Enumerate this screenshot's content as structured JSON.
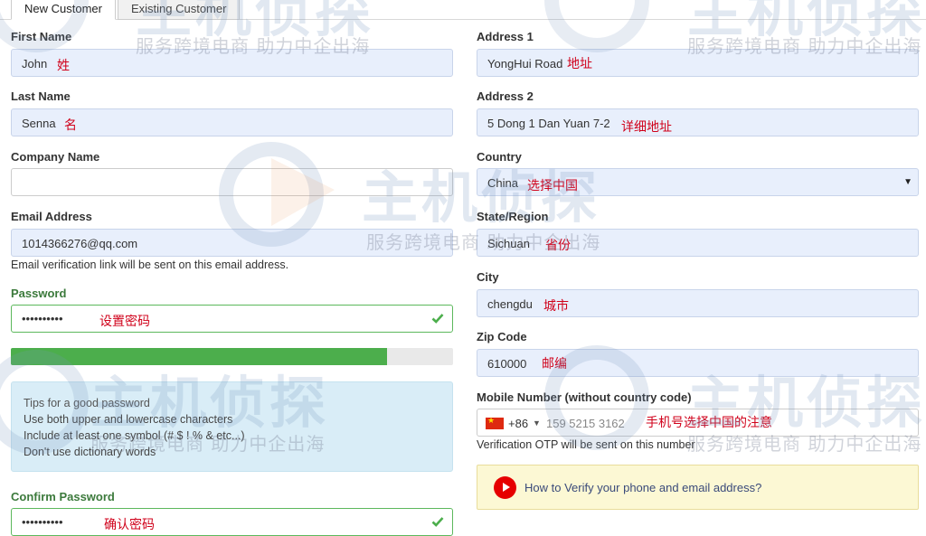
{
  "tabs": [
    {
      "label": "New Customer",
      "active": true
    },
    {
      "label": "Existing Customer",
      "active": false
    }
  ],
  "left": {
    "first_name": {
      "label": "First Name",
      "value": "John",
      "note": "姓"
    },
    "last_name": {
      "label": "Last Name",
      "value": "Senna",
      "note": "名"
    },
    "company": {
      "label": "Company Name",
      "value": ""
    },
    "email": {
      "label": "Email Address",
      "value": "1014366276@qq.com",
      "help": "Email verification link will be sent on this email address."
    },
    "password": {
      "label": "Password",
      "value": "••••••••••",
      "note": "设置密码",
      "strength": 0.85
    },
    "tips": {
      "title": "Tips for a good password",
      "lines": [
        "Use both upper and lowercase characters",
        "Include at least one symbol (# $ ! % & etc...)",
        "Don't use dictionary words"
      ]
    },
    "confirm": {
      "label": "Confirm Password",
      "value": "••••••••••",
      "note": "确认密码"
    }
  },
  "right": {
    "address1": {
      "label": "Address 1",
      "value": "YongHui Road",
      "note": "地址"
    },
    "address2": {
      "label": "Address 2",
      "value": "5 Dong 1 Dan Yuan 7-2",
      "note": "详细地址"
    },
    "country": {
      "label": "Country",
      "value": "China",
      "note": "选择中国"
    },
    "state": {
      "label": "State/Region",
      "value": "Sichuan",
      "note": "省份"
    },
    "city": {
      "label": "City",
      "value": "chengdu",
      "note": "城市"
    },
    "zip": {
      "label": "Zip Code",
      "value": "610000",
      "note": "邮编"
    },
    "mobile": {
      "label": "Mobile Number (without country code)",
      "code": "+86",
      "value": "159 5215 3162",
      "note": "手机号选择中国的注意",
      "help": "Verification OTP will be sent on this number"
    },
    "verify_link": "How to Verify your phone and email address?"
  },
  "watermark": {
    "brand": "主机侦探",
    "slogan": "服务跨境电商 助力中企出海"
  },
  "colors": {
    "field_bg": "#e8effc",
    "valid_green": "#5cb85c",
    "strength_green": "#4cae4c",
    "note_red": "#d0021b",
    "tips_bg": "#d9edf7",
    "verify_bg": "#fcf8d4",
    "play_red": "#e60000"
  }
}
